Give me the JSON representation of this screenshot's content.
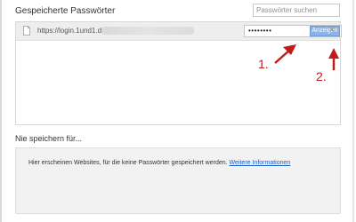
{
  "saved_passwords": {
    "title": "Gespeicherte Passwörter",
    "search_placeholder": "Passwörter suchen"
  },
  "entries": [
    {
      "url": "https://login.1und1.de/",
      "password_mask": "••••••••",
      "show_label": "Anzeigen",
      "remove_glyph": "×"
    }
  ],
  "never_saved": {
    "title": "Nie speichern für...",
    "info_text": "Hier erscheinen Websites, für die keine Passwörter gespeichert werden.",
    "link_text": "Weitere Informationen"
  },
  "annotations": {
    "label_1": "1.",
    "label_2": "2.",
    "color": "#c01c1c"
  },
  "icons": {
    "entry_icon": "document-icon",
    "remove_icon": "close-icon"
  },
  "colors": {
    "row_background": "#eeeeee",
    "show_button": "#8db3e6",
    "link": "#1a5fc8"
  }
}
